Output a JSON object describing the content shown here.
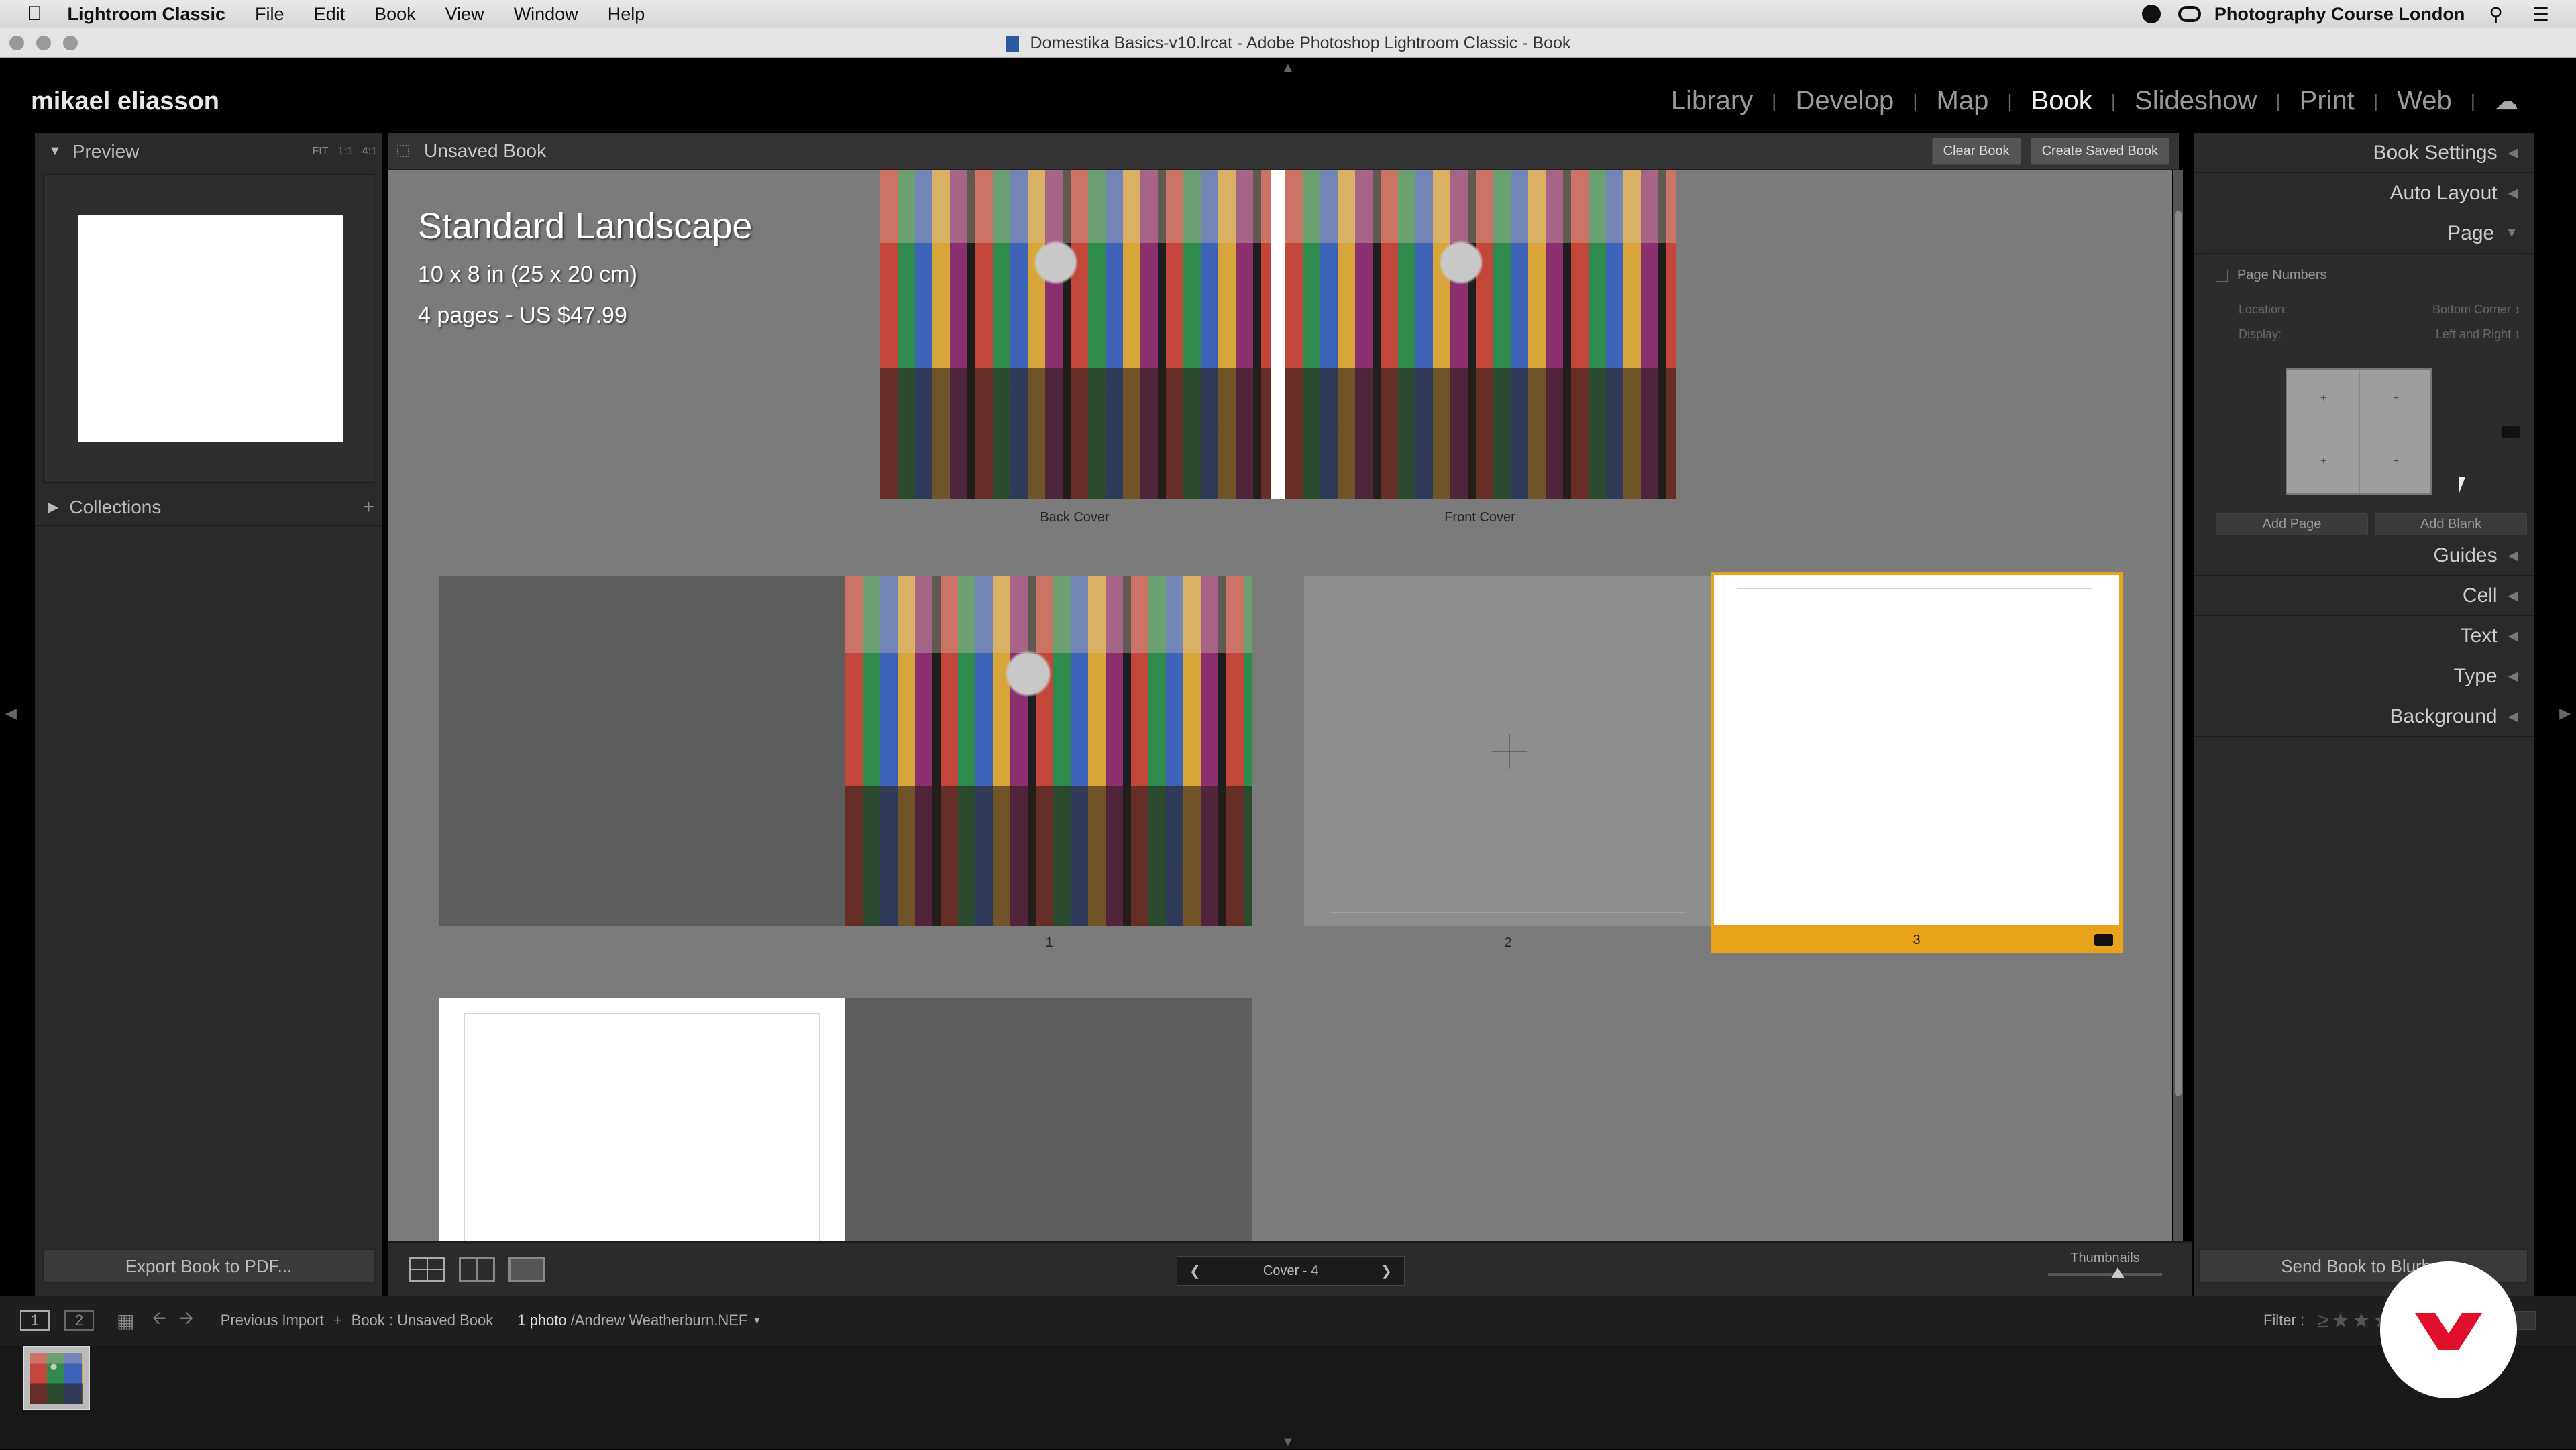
{
  "menubar": {
    "app": "Lightroom Classic",
    "items": [
      "File",
      "Edit",
      "Book",
      "View",
      "Window",
      "Help"
    ],
    "right_text": "Photography Course London"
  },
  "window": {
    "title": "Domestika Basics-v10.lrcat - Adobe Photoshop Lightroom Classic - Book"
  },
  "identity_plate": "mikael eliasson",
  "modules": {
    "library": "Library",
    "develop": "Develop",
    "map": "Map",
    "book": "Book",
    "slideshow": "Slideshow",
    "print": "Print",
    "web": "Web",
    "active": "Book"
  },
  "left_panel": {
    "preview_label": "Preview",
    "zoom": [
      "FIT",
      "1:1",
      "4:1"
    ],
    "collections_label": "Collections",
    "export_button": "Export Book to PDF..."
  },
  "center": {
    "book_name": "Unsaved Book",
    "clear_book": "Clear Book",
    "create_saved_book": "Create Saved Book",
    "info_title": "Standard Landscape",
    "info_size": "10 x 8 in (25 x 20 cm)",
    "info_pages": "4 pages - US $47.99",
    "back_cover_label": "Back Cover",
    "front_cover_label": "Front Cover",
    "page_labels": [
      "1",
      "2",
      "3"
    ],
    "page_indicator": "Cover - 4",
    "thumbnails_label": "Thumbnails"
  },
  "right_panel": {
    "sections": [
      "Book Settings",
      "Auto Layout",
      "Page"
    ],
    "page_numbers_label": "Page Numbers",
    "location_label": "Location:",
    "location_value": "Bottom Corner",
    "display_label": "Display:",
    "display_value": "Left and Right",
    "add_page": "Add Page",
    "add_blank": "Add Blank",
    "lower_sections": [
      "Guides",
      "Cell",
      "Text",
      "Type",
      "Background"
    ],
    "send_button": "Send Book to Blurb..."
  },
  "filmstrip_bar": {
    "pages": [
      "1",
      "2"
    ],
    "previous_import": "Previous Import",
    "source": "Book : Unsaved Book",
    "photo_count": "1 photo",
    "filename": "/Andrew Weatherburn.NEF",
    "filter_label": "Filter :"
  },
  "colors": {
    "selection": "#e8a31a",
    "canvas": "#7b7b7b",
    "panel": "#2a2a2a"
  }
}
